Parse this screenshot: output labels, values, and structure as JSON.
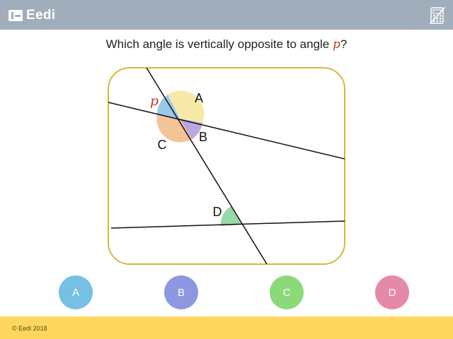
{
  "header": {
    "logo_text": "Eedi",
    "calculator_icon": "calculator-icon"
  },
  "question": {
    "prefix": "Which angle is vertically opposite to angle ",
    "variable": "p",
    "suffix": "?"
  },
  "diagram": {
    "labels": {
      "p": "p",
      "A": "A",
      "B": "B",
      "C": "C",
      "D": "D"
    },
    "colors": {
      "frame": "#d4b93a",
      "angle_p": "#8ec3e6",
      "angle_A": "#f5e79e",
      "angle_B": "#b39ddb",
      "angle_C": "#f3be8e",
      "angle_D": "#8fd3a0"
    }
  },
  "options": [
    {
      "label": "A",
      "color": "#74c1e3"
    },
    {
      "label": "B",
      "color": "#8e98e0"
    },
    {
      "label": "C",
      "color": "#8cd97a"
    },
    {
      "label": "D",
      "color": "#e48aa8"
    }
  ],
  "footer": {
    "copyright": "© Eedi 2018"
  }
}
